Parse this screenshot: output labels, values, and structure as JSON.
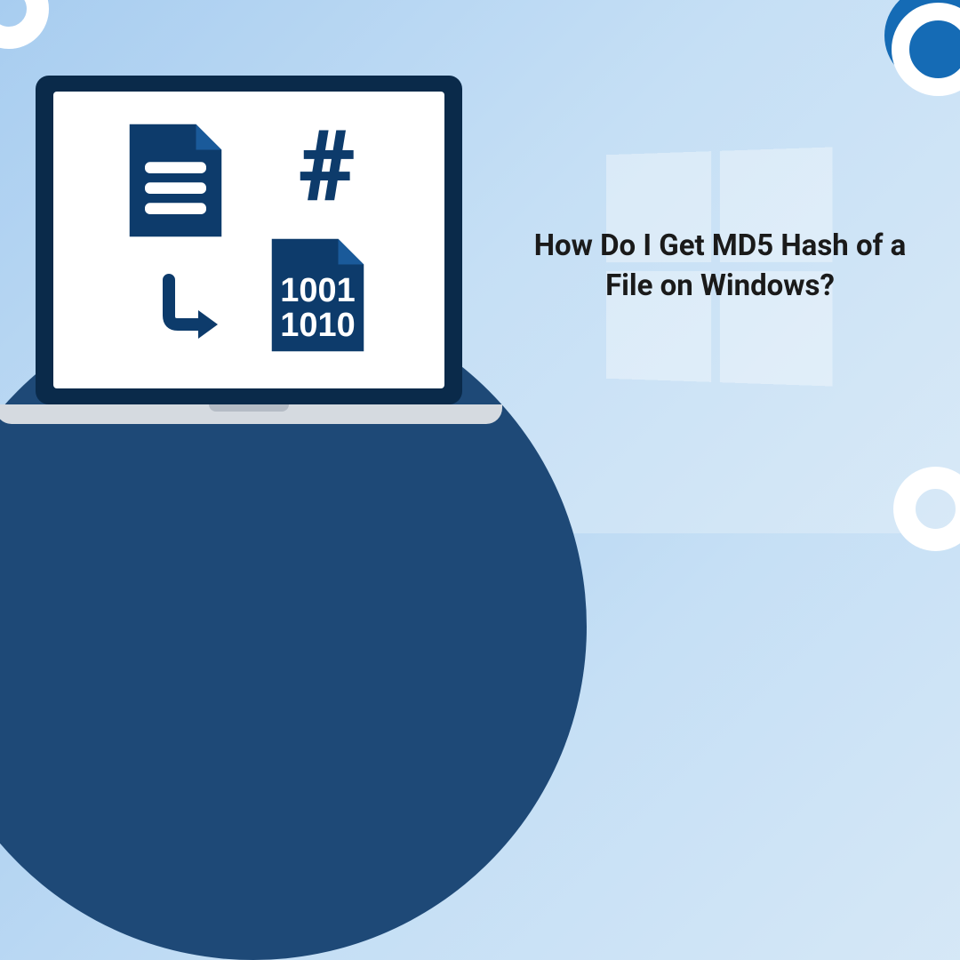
{
  "title": "How Do I Get MD5 Hash of a File on Windows?",
  "icons": {
    "document": "document-icon",
    "hash": "hash-icon",
    "binary": "binary-file-icon",
    "arrow": "arrow-icon",
    "windows": "windows-logo-icon"
  },
  "colors": {
    "dark_blue": "#0d3b6b",
    "circle_blue": "#1e4977",
    "bg_light": "#c5dff5"
  }
}
